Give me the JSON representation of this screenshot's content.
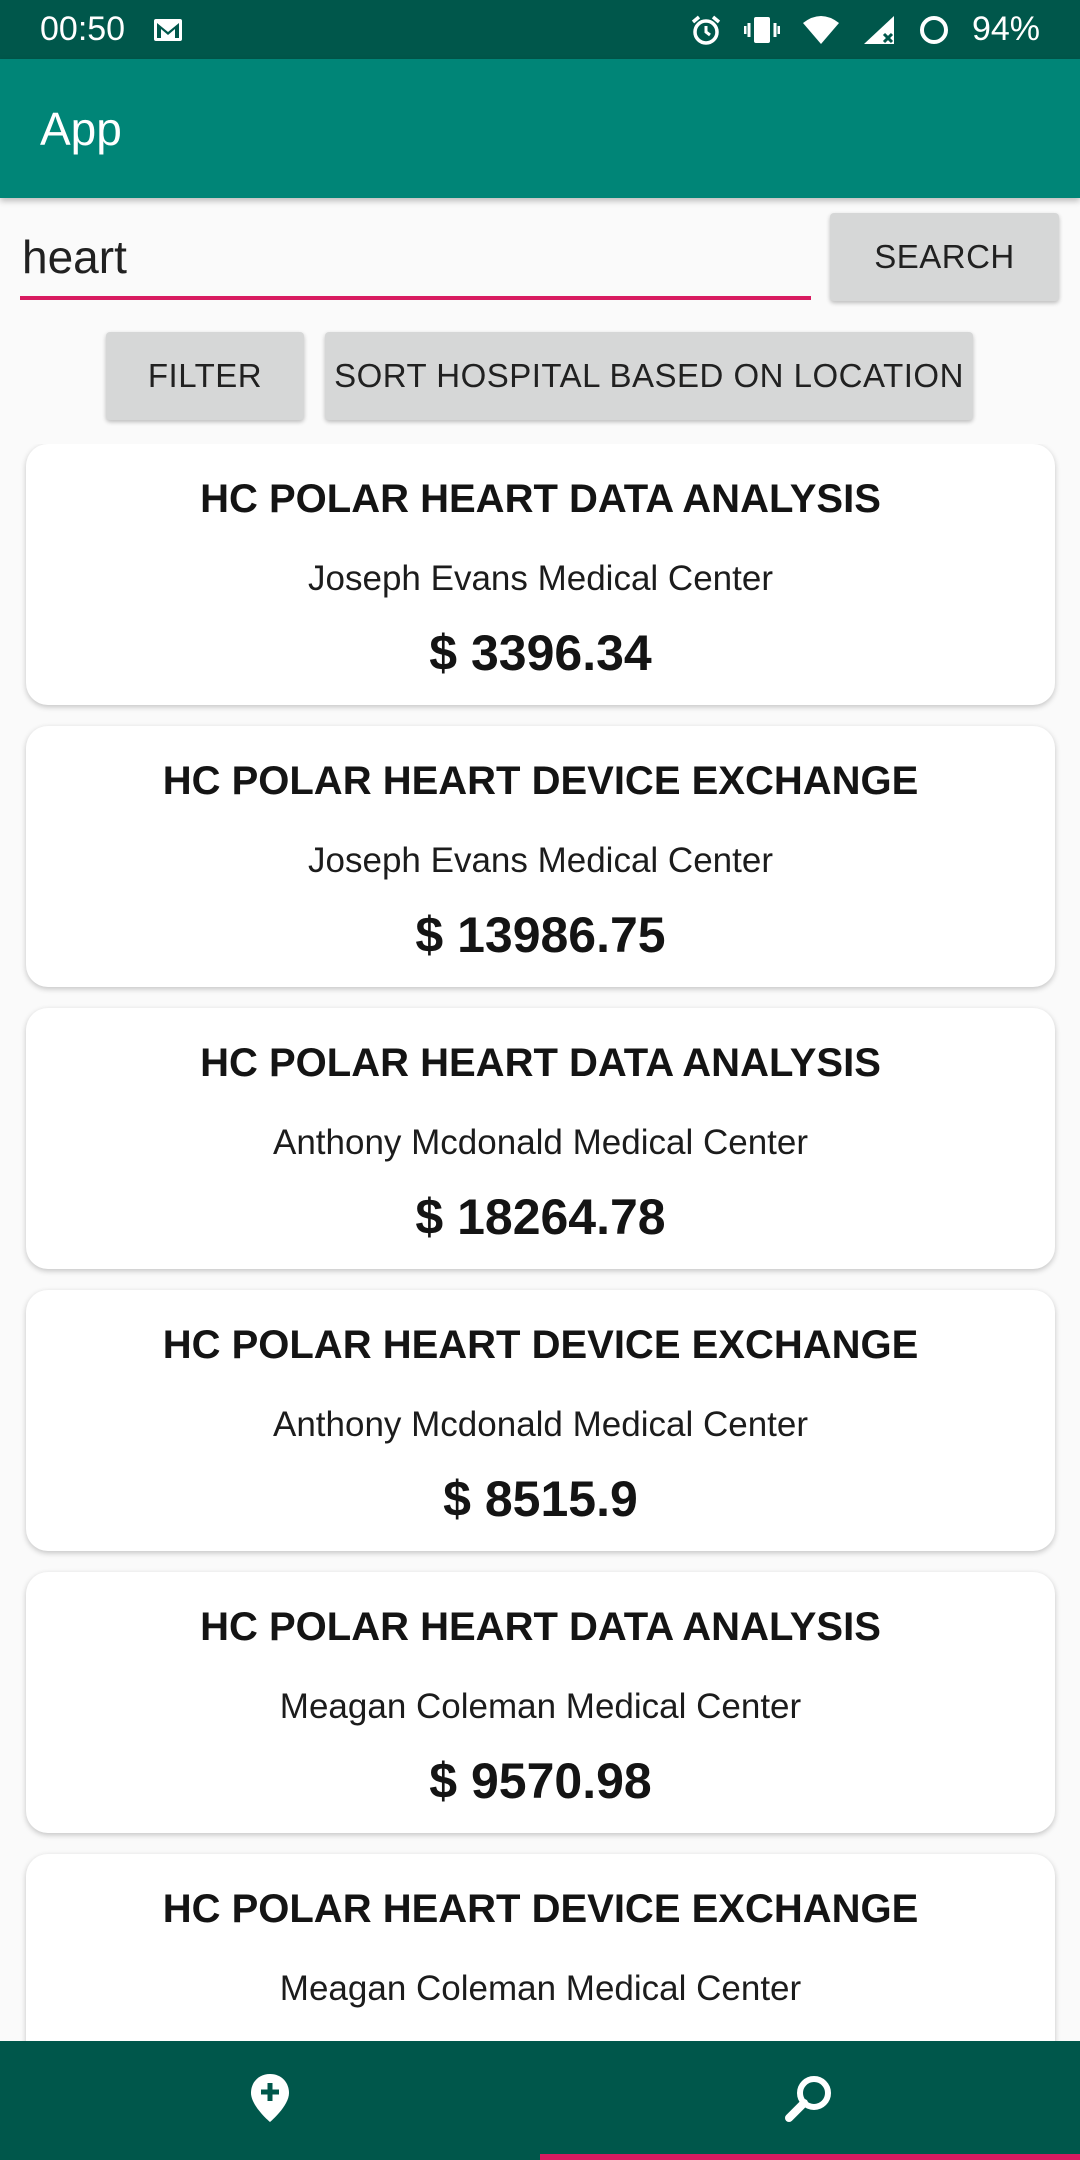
{
  "status_bar": {
    "time": "00:50",
    "battery": "94%",
    "icons": [
      "gmail-icon",
      "alarm-icon",
      "vibrate-icon",
      "wifi-icon",
      "signal-icon",
      "battery-icon"
    ]
  },
  "app_bar": {
    "title": "App"
  },
  "search": {
    "value": "heart",
    "button_label": "SEARCH"
  },
  "actions": {
    "filter_label": "FILTER",
    "sort_label": "SORT HOSPITAL BASED ON LOCATION"
  },
  "results": [
    {
      "title": "HC POLAR HEART DATA ANALYSIS",
      "hospital": "Joseph Evans Medical Center",
      "price": "$ 3396.34"
    },
    {
      "title": "HC POLAR HEART DEVICE EXCHANGE",
      "hospital": "Joseph Evans Medical Center",
      "price": "$ 13986.75"
    },
    {
      "title": "HC POLAR HEART DATA ANALYSIS",
      "hospital": "Anthony Mcdonald Medical Center",
      "price": "$ 18264.78"
    },
    {
      "title": "HC POLAR HEART DEVICE EXCHANGE",
      "hospital": "Anthony Mcdonald Medical Center",
      "price": "$ 8515.9"
    },
    {
      "title": "HC POLAR HEART DATA ANALYSIS",
      "hospital": "Meagan Coleman Medical Center",
      "price": "$ 9570.98"
    },
    {
      "title": "HC POLAR HEART DEVICE EXCHANGE",
      "hospital": "Meagan Coleman Medical Center",
      "price": ""
    }
  ],
  "bottom_nav": {
    "items": [
      {
        "icon": "add-location-icon",
        "selected": false
      },
      {
        "icon": "search-icon",
        "selected": true
      }
    ]
  },
  "colors": {
    "status_bar": "#00574b",
    "app_bar": "#008577",
    "accent": "#d81b60",
    "button": "#d6d7d7",
    "background": "#fafafa"
  }
}
